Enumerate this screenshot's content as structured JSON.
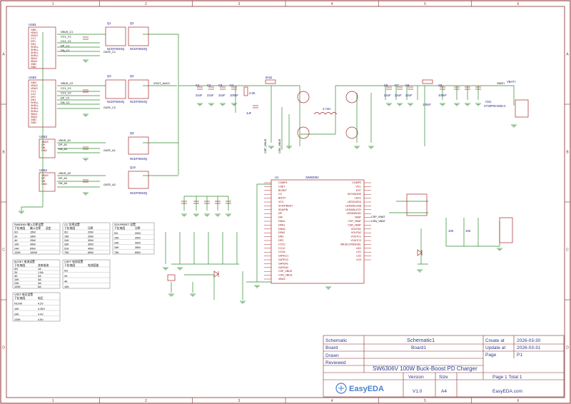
{
  "border": {
    "columns": [
      "1",
      "2",
      "3",
      "4",
      "5",
      "6"
    ],
    "rows": [
      "A",
      "B",
      "C",
      "D"
    ]
  },
  "usb": [
    {
      "name": "USB1",
      "pins": [
        "GND",
        "VBUS",
        "VBUS",
        "CC1",
        "DP1",
        "DN1",
        "SHELL",
        "SHELL",
        "SHELL",
        "SHELL",
        "SBU1",
        "SBU2",
        "GND",
        "GND"
      ]
    },
    {
      "name": "USB2",
      "pins": [
        "GND",
        "VBUS",
        "VBUS",
        "CC1",
        "CC2",
        "DP1",
        "DN1",
        "SHELL",
        "SHELL",
        "SHELL",
        "SHELL",
        "SBU1",
        "SBU2",
        "GND",
        "GND"
      ]
    },
    {
      "name": "USB3",
      "pins": [
        "VBUS",
        "DP",
        "DN",
        "GND"
      ]
    },
    {
      "name": "USB4",
      "pins": [
        "VBUS",
        "DP",
        "DN",
        "GND"
      ]
    }
  ],
  "nets": {
    "usb1": [
      "VBUS_C1",
      "CC1_C1",
      "CC2_C1",
      "DP_C1",
      "DN_C1"
    ],
    "usb2": [
      "VBUS_C2",
      "CC1_C2",
      "CC2_C2",
      "DP_C2",
      "DN_C2"
    ],
    "usb3": [
      "VBUS_A1",
      "DP_A1",
      "DN_A1"
    ],
    "usb4": [
      "VBUS_A2",
      "DP_A2",
      "DN_A2"
    ],
    "gates": [
      "GATE_C1",
      "GATE_C2",
      "GATE_A1",
      "GATE_A2"
    ],
    "vout": "VOUT_AACC",
    "vbat": "VBAT+",
    "csp": [
      "CSP_VBUS",
      "CSN_VBUS"
    ],
    "csvbat": [
      "CSP_VBAT",
      "CSN_VBAT"
    ]
  },
  "mosfets": [
    {
      "ref": "Q1",
      "part": "NCEP3040Q"
    },
    {
      "ref": "Q2",
      "part": "NCEP3040Q"
    },
    {
      "ref": "Q3",
      "part": "NCEP3040Q"
    },
    {
      "ref": "Q4",
      "part": "NCEP3040Q"
    },
    {
      "ref": "Q9",
      "part": "NCEP3040Q"
    },
    {
      "ref": "Q10",
      "part": "NCEP3040Q"
    }
  ],
  "power_caps": [
    {
      "ref": "C1",
      "val": "22uF"
    },
    {
      "ref": "C2",
      "val": "22uF"
    },
    {
      "ref": "C3",
      "val": "22uF"
    },
    {
      "ref": "C4",
      "val": "100nF"
    },
    {
      "ref": "C6",
      "val": "22uF"
    },
    {
      "ref": "C7",
      "val": "22uF"
    },
    {
      "ref": "C8",
      "val": "22uF"
    },
    {
      "ref": "C9",
      "val": "100nF"
    }
  ],
  "labels": {
    "r_2m5": "2.5K",
    "r_10k": "10K",
    "r_5m": "5mΩ",
    "cap_1uf": "1uF",
    "cap_100nf": "100nF",
    "inductor": "4.7uH",
    "conn": "XT30PW-M30.G",
    "cn": "CN1",
    "vbat_label": "VBAT+"
  },
  "ic": {
    "ref": "U1",
    "part": "SW6306V",
    "left_pins": [
      "COMP1",
      "CSET",
      "BCSET",
      "CC",
      "BOOT",
      "VCC",
      "SCK/PBSET",
      "SDA/PB",
      "DP",
      "DM",
      "DNA1",
      "DPA1",
      "DNA2",
      "DPA2",
      "DNC",
      "DPC",
      "CC2C",
      "CC1C",
      "CC2A",
      "GATEC1",
      "GATEC2",
      "GATEA1",
      "GATEA2",
      "CSP_VBUS",
      "CSN_VBUS",
      "VBUS"
    ],
    "right_pins": [
      "COMP2",
      "VCC",
      "EXT",
      "KEY/MODE",
      "LED1",
      "LED2/LED4",
      "LED3/BLUSB",
      "LED4/BLUTH",
      "LED5/WLED",
      "VBAT",
      "CSP_VBAT",
      "CSN_VBAT",
      "VOUTA1",
      "VOUTA2",
      "VOUTC1",
      "VOUTC2",
      "VBUSC2/VBUSEL",
      "LDO",
      "LD1",
      "LD2",
      "LD3"
    ]
  },
  "tables": [
    {
      "title": "SW6306V 输入功率设置",
      "cols": [
        "下拉电阻",
        "输入功率",
        "设定"
      ],
      "rows": [
        [
          "0Ω",
          "15W",
          ""
        ],
        [
          "2K",
          "18W",
          ""
        ],
        [
          "4K",
          "25W",
          ""
        ],
        [
          "10K",
          "45W",
          ""
        ],
        [
          "24K",
          "65W",
          ""
        ],
        [
          "120K",
          "100W",
          ""
        ]
      ]
    },
    {
      "title": "CC 功率设置",
      "cols": [
        "下拉电阻",
        "功率"
      ],
      "rows": [
        [
          "0Ω",
          "20W"
        ],
        [
          "15K",
          "25W"
        ],
        [
          "24K",
          "30W"
        ],
        [
          "33K",
          "35W"
        ],
        [
          "51K",
          "45W"
        ],
        [
          "75K",
          "65W"
        ]
      ]
    },
    {
      "title": "SCK/PBSET 设置",
      "cols": [
        "下拉电阻",
        "功率"
      ],
      "rows": [
        [
          "0Ω",
          "20W"
        ],
        [
          "15K",
          "25W"
        ],
        [
          "24K",
          "30W"
        ],
        [
          "33K",
          "35W"
        ],
        [
          "75K",
          "65W"
        ]
      ]
    },
    {
      "title": "BCSET 电流设置",
      "cols": [
        "下拉电阻",
        "充电电流"
      ],
      "rows": [
        [
          "0Ω",
          "1A"
        ],
        [
          "2K",
          "1.5A"
        ],
        [
          "4K",
          "2A"
        ],
        [
          "10K",
          "3A"
        ],
        [
          "24K",
          "4A"
        ],
        [
          "120K",
          "5A"
        ]
      ]
    },
    {
      "title": "CSET 电池设置",
      "cols": [
        "下拉电阻",
        "电池容量"
      ],
      "rows": [
        [
          "0Ω",
          ""
        ],
        [
          "2K",
          ""
        ],
        [
          "4K",
          ""
        ],
        [
          "10K",
          ""
        ]
      ]
    },
    {
      "title": "VSET 电压设置",
      "cols": [
        "下拉电阻",
        "电压"
      ],
      "rows": [
        [
          "NC/0K",
          "4.2V"
        ],
        [
          "10K",
          "4.35V"
        ],
        [
          "24K",
          "4.4V"
        ],
        [
          "120K",
          "4.5V"
        ]
      ]
    }
  ],
  "title_block": {
    "schematic_label": "Schematic",
    "schematic_value": "Schematic1",
    "board_label": "Board",
    "board_value": "Board1",
    "drawn_label": "Drawn",
    "reviewed_label": "Reviewed",
    "title": "SW6306V 100W Buck-Boost PD Charger",
    "create_label": "Create at",
    "create_value": "2026-03-30",
    "update_label": "Update at",
    "update_value": "2026-03-31",
    "page_label": "Page",
    "page_value": "P1",
    "version_label": "Version",
    "size_label": "Size",
    "version_value": "V1.0",
    "size_value": "A4",
    "page_total": "Page  1  Total  1",
    "logo": "EasyEDA",
    "site": "EasyEDA.com"
  },
  "colors": {
    "frame": "#8b2b2b",
    "wire": "#2e8b2e",
    "comp": "#a52a2a",
    "text": "#1a1a80",
    "logo": "#4a7fd0"
  }
}
